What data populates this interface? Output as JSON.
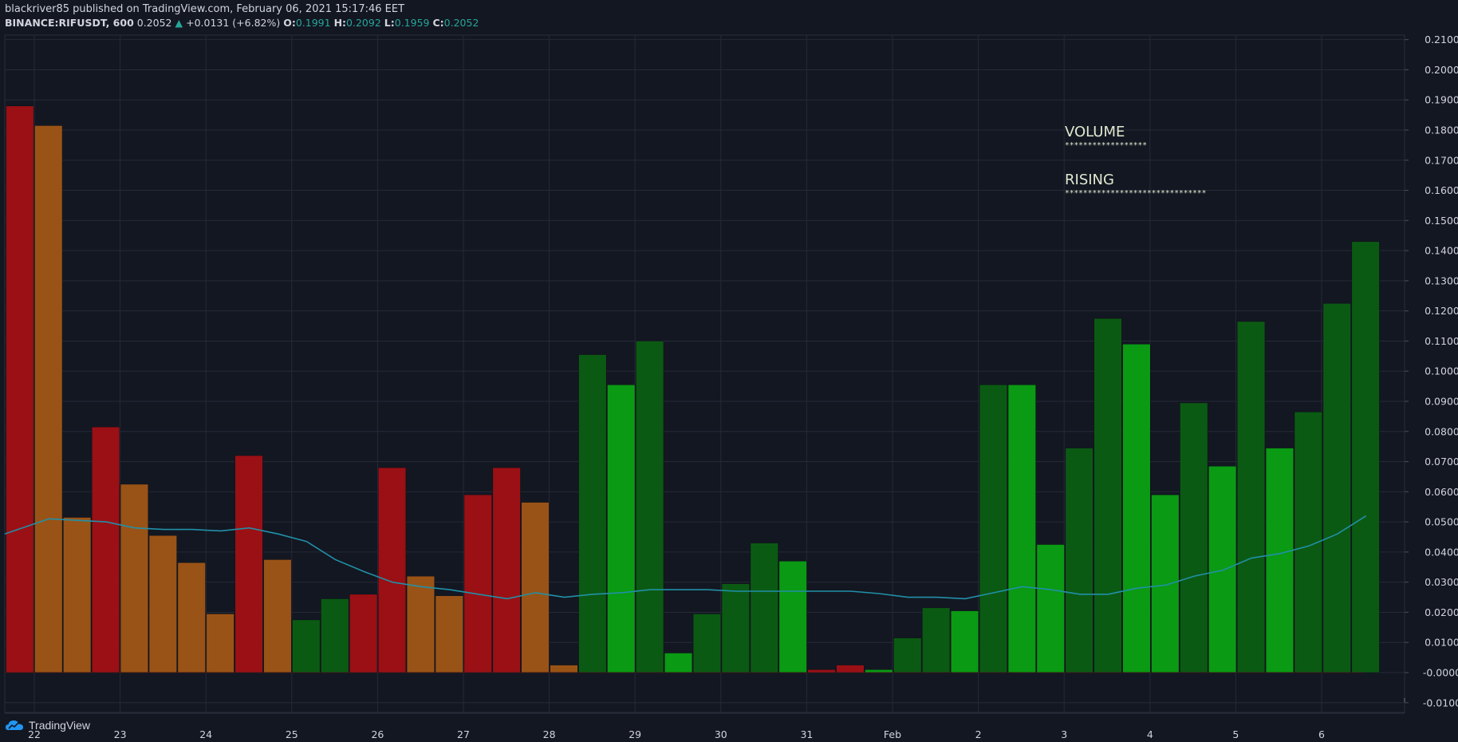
{
  "header": {
    "publisher_line": "blackriver85 published on TradingView.com, February 06, 2021 15:17:46 EET",
    "symbol": "BINANCE:RIFUSDT, 600",
    "last": "0.2052",
    "change": "+0.0131 (+6.82%)",
    "o_label": "O:",
    "o": "0.1991",
    "h_label": "H:",
    "h": "0.2092",
    "l_label": "L:",
    "l": "0.1959",
    "c_label": "C:",
    "c": "0.2052"
  },
  "annotations": {
    "volume_title": "VOLUME",
    "volume_stars": "******************",
    "rising_title": "RISING",
    "rising_stars": "*******************************"
  },
  "footer": {
    "brand": "TradingView"
  },
  "colors": {
    "background": "#131722",
    "grid": "#262a37",
    "text": "#d1d4dc",
    "red": "#9a1015",
    "orange": "#9a5316",
    "dark_green": "#0b5a13",
    "bright_green": "#0a9a13",
    "ma_line": "#2190a8",
    "up": "#26a69a"
  },
  "chart_data": {
    "type": "bar",
    "x_tick_labels": [
      "22",
      "23",
      "24",
      "25",
      "26",
      "27",
      "28",
      "29",
      "30",
      "31",
      "Feb",
      "2",
      "3",
      "4",
      "5",
      "6"
    ],
    "y_tick_labels": [
      "0.2100",
      "0.2000",
      "0.1900",
      "0.1800",
      "0.1700",
      "0.1600",
      "0.1500",
      "0.1400",
      "0.1300",
      "0.1200",
      "0.1100",
      "0.1000",
      "0.0900",
      "0.0800",
      "0.0700",
      "0.0600",
      "0.0500",
      "0.0400",
      "0.0300",
      "0.0200",
      "0.0100",
      "-0.0000",
      "-0.0100"
    ],
    "ylim": [
      -0.0135,
      0.2115
    ],
    "grid": true,
    "bars": [
      {
        "value": 0.188,
        "color": "red"
      },
      {
        "value": 0.1815,
        "color": "orange"
      },
      {
        "value": 0.0515,
        "color": "orange"
      },
      {
        "value": 0.0815,
        "color": "red"
      },
      {
        "value": 0.0625,
        "color": "orange"
      },
      {
        "value": 0.0455,
        "color": "orange"
      },
      {
        "value": 0.0365,
        "color": "orange"
      },
      {
        "value": 0.0195,
        "color": "orange"
      },
      {
        "value": 0.072,
        "color": "red"
      },
      {
        "value": 0.0375,
        "color": "orange"
      },
      {
        "value": 0.0175,
        "color": "dark_green"
      },
      {
        "value": 0.0245,
        "color": "dark_green"
      },
      {
        "value": 0.026,
        "color": "red"
      },
      {
        "value": 0.068,
        "color": "red"
      },
      {
        "value": 0.032,
        "color": "orange"
      },
      {
        "value": 0.0255,
        "color": "orange"
      },
      {
        "value": 0.059,
        "color": "red"
      },
      {
        "value": 0.068,
        "color": "red"
      },
      {
        "value": 0.0565,
        "color": "orange"
      },
      {
        "value": 0.0025,
        "color": "orange"
      },
      {
        "value": 0.1055,
        "color": "dark_green"
      },
      {
        "value": 0.0955,
        "color": "bright_green"
      },
      {
        "value": 0.11,
        "color": "dark_green"
      },
      {
        "value": 0.0065,
        "color": "bright_green"
      },
      {
        "value": 0.0195,
        "color": "dark_green"
      },
      {
        "value": 0.0295,
        "color": "dark_green"
      },
      {
        "value": 0.043,
        "color": "dark_green"
      },
      {
        "value": 0.037,
        "color": "bright_green"
      },
      {
        "value": 0.001,
        "color": "red"
      },
      {
        "value": 0.0025,
        "color": "red"
      },
      {
        "value": 0.001,
        "color": "bright_green"
      },
      {
        "value": 0.0115,
        "color": "dark_green"
      },
      {
        "value": 0.0215,
        "color": "dark_green"
      },
      {
        "value": 0.0205,
        "color": "bright_green"
      },
      {
        "value": 0.0955,
        "color": "dark_green"
      },
      {
        "value": 0.0955,
        "color": "bright_green"
      },
      {
        "value": 0.0425,
        "color": "bright_green"
      },
      {
        "value": 0.0745,
        "color": "dark_green"
      },
      {
        "value": 0.1175,
        "color": "dark_green"
      },
      {
        "value": 0.109,
        "color": "bright_green"
      },
      {
        "value": 0.059,
        "color": "bright_green"
      },
      {
        "value": 0.0895,
        "color": "dark_green"
      },
      {
        "value": 0.0685,
        "color": "bright_green"
      },
      {
        "value": 0.1165,
        "color": "dark_green"
      },
      {
        "value": 0.0745,
        "color": "bright_green"
      },
      {
        "value": 0.0865,
        "color": "dark_green"
      },
      {
        "value": 0.1225,
        "color": "dark_green"
      },
      {
        "value": 0.143,
        "color": "dark_green"
      }
    ],
    "moving_average": [
      0.046,
      0.051,
      0.0505,
      0.05,
      0.048,
      0.0475,
      0.0475,
      0.047,
      0.048,
      0.046,
      0.0435,
      0.0375,
      0.0335,
      0.03,
      0.0285,
      0.0275,
      0.026,
      0.0245,
      0.0265,
      0.025,
      0.026,
      0.0265,
      0.0275,
      0.0275,
      0.0275,
      0.027,
      0.027,
      0.027,
      0.027,
      0.027,
      0.0262,
      0.025,
      0.025,
      0.0245,
      0.0265,
      0.0285,
      0.0275,
      0.026,
      0.026,
      0.028,
      0.029,
      0.032,
      0.034,
      0.038,
      0.0395,
      0.042,
      0.046,
      0.052
    ]
  }
}
